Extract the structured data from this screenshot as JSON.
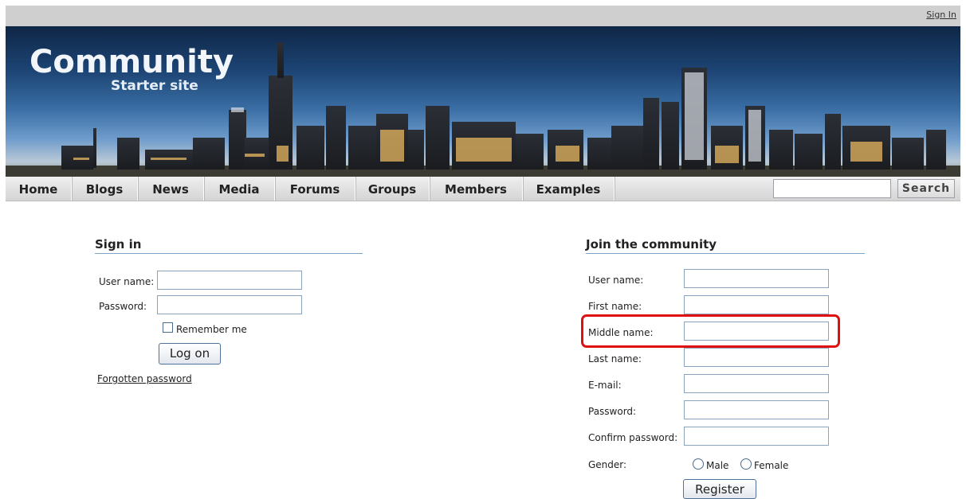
{
  "header": {
    "sign_in_link": "Sign In"
  },
  "banner": {
    "title": "Community",
    "subtitle": "Starter site"
  },
  "nav": {
    "items": [
      {
        "label": "Home"
      },
      {
        "label": "Blogs"
      },
      {
        "label": "News"
      },
      {
        "label": "Media"
      },
      {
        "label": "Forums"
      },
      {
        "label": "Groups"
      },
      {
        "label": "Members"
      },
      {
        "label": "Examples"
      }
    ],
    "search_button": "Search",
    "search_value": ""
  },
  "signin": {
    "title": "Sign in",
    "username_label": "User name:",
    "password_label": "Password:",
    "remember_label": "Remember me",
    "logon_button": "Log on",
    "forgot_link": "Forgotten password"
  },
  "join": {
    "title": "Join the community",
    "fields": [
      {
        "label": "User name:"
      },
      {
        "label": "First name:"
      },
      {
        "label": "Middle name:"
      },
      {
        "label": "Last name:"
      },
      {
        "label": "E-mail:"
      },
      {
        "label": "Password:"
      },
      {
        "label": "Confirm password:"
      }
    ],
    "gender_label": "Gender:",
    "gender_options": [
      "Male",
      "Female"
    ],
    "register_button": "Register"
  },
  "colors": {
    "highlight": "#e01010",
    "section_rule": "#7aa3c8",
    "topbar": "#cfcfcf"
  }
}
